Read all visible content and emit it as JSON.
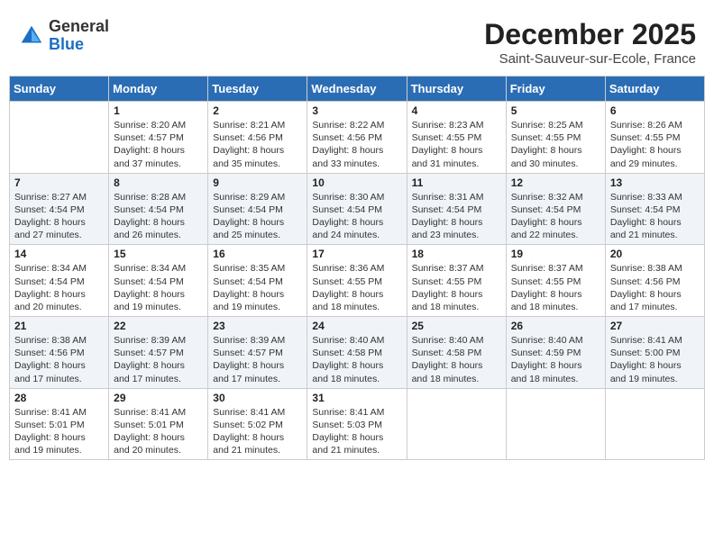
{
  "header": {
    "logo_general": "General",
    "logo_blue": "Blue",
    "title": "December 2025",
    "subtitle": "Saint-Sauveur-sur-Ecole, France"
  },
  "days_of_week": [
    "Sunday",
    "Monday",
    "Tuesday",
    "Wednesday",
    "Thursday",
    "Friday",
    "Saturday"
  ],
  "weeks": [
    {
      "days": [
        {
          "number": "",
          "info": ""
        },
        {
          "number": "1",
          "info": "Sunrise: 8:20 AM\nSunset: 4:57 PM\nDaylight: 8 hours\nand 37 minutes."
        },
        {
          "number": "2",
          "info": "Sunrise: 8:21 AM\nSunset: 4:56 PM\nDaylight: 8 hours\nand 35 minutes."
        },
        {
          "number": "3",
          "info": "Sunrise: 8:22 AM\nSunset: 4:56 PM\nDaylight: 8 hours\nand 33 minutes."
        },
        {
          "number": "4",
          "info": "Sunrise: 8:23 AM\nSunset: 4:55 PM\nDaylight: 8 hours\nand 31 minutes."
        },
        {
          "number": "5",
          "info": "Sunrise: 8:25 AM\nSunset: 4:55 PM\nDaylight: 8 hours\nand 30 minutes."
        },
        {
          "number": "6",
          "info": "Sunrise: 8:26 AM\nSunset: 4:55 PM\nDaylight: 8 hours\nand 29 minutes."
        }
      ]
    },
    {
      "days": [
        {
          "number": "7",
          "info": "Sunrise: 8:27 AM\nSunset: 4:54 PM\nDaylight: 8 hours\nand 27 minutes."
        },
        {
          "number": "8",
          "info": "Sunrise: 8:28 AM\nSunset: 4:54 PM\nDaylight: 8 hours\nand 26 minutes."
        },
        {
          "number": "9",
          "info": "Sunrise: 8:29 AM\nSunset: 4:54 PM\nDaylight: 8 hours\nand 25 minutes."
        },
        {
          "number": "10",
          "info": "Sunrise: 8:30 AM\nSunset: 4:54 PM\nDaylight: 8 hours\nand 24 minutes."
        },
        {
          "number": "11",
          "info": "Sunrise: 8:31 AM\nSunset: 4:54 PM\nDaylight: 8 hours\nand 23 minutes."
        },
        {
          "number": "12",
          "info": "Sunrise: 8:32 AM\nSunset: 4:54 PM\nDaylight: 8 hours\nand 22 minutes."
        },
        {
          "number": "13",
          "info": "Sunrise: 8:33 AM\nSunset: 4:54 PM\nDaylight: 8 hours\nand 21 minutes."
        }
      ]
    },
    {
      "days": [
        {
          "number": "14",
          "info": "Sunrise: 8:34 AM\nSunset: 4:54 PM\nDaylight: 8 hours\nand 20 minutes."
        },
        {
          "number": "15",
          "info": "Sunrise: 8:34 AM\nSunset: 4:54 PM\nDaylight: 8 hours\nand 19 minutes."
        },
        {
          "number": "16",
          "info": "Sunrise: 8:35 AM\nSunset: 4:54 PM\nDaylight: 8 hours\nand 19 minutes."
        },
        {
          "number": "17",
          "info": "Sunrise: 8:36 AM\nSunset: 4:55 PM\nDaylight: 8 hours\nand 18 minutes."
        },
        {
          "number": "18",
          "info": "Sunrise: 8:37 AM\nSunset: 4:55 PM\nDaylight: 8 hours\nand 18 minutes."
        },
        {
          "number": "19",
          "info": "Sunrise: 8:37 AM\nSunset: 4:55 PM\nDaylight: 8 hours\nand 18 minutes."
        },
        {
          "number": "20",
          "info": "Sunrise: 8:38 AM\nSunset: 4:56 PM\nDaylight: 8 hours\nand 17 minutes."
        }
      ]
    },
    {
      "days": [
        {
          "number": "21",
          "info": "Sunrise: 8:38 AM\nSunset: 4:56 PM\nDaylight: 8 hours\nand 17 minutes."
        },
        {
          "number": "22",
          "info": "Sunrise: 8:39 AM\nSunset: 4:57 PM\nDaylight: 8 hours\nand 17 minutes."
        },
        {
          "number": "23",
          "info": "Sunrise: 8:39 AM\nSunset: 4:57 PM\nDaylight: 8 hours\nand 17 minutes."
        },
        {
          "number": "24",
          "info": "Sunrise: 8:40 AM\nSunset: 4:58 PM\nDaylight: 8 hours\nand 18 minutes."
        },
        {
          "number": "25",
          "info": "Sunrise: 8:40 AM\nSunset: 4:58 PM\nDaylight: 8 hours\nand 18 minutes."
        },
        {
          "number": "26",
          "info": "Sunrise: 8:40 AM\nSunset: 4:59 PM\nDaylight: 8 hours\nand 18 minutes."
        },
        {
          "number": "27",
          "info": "Sunrise: 8:41 AM\nSunset: 5:00 PM\nDaylight: 8 hours\nand 19 minutes."
        }
      ]
    },
    {
      "days": [
        {
          "number": "28",
          "info": "Sunrise: 8:41 AM\nSunset: 5:01 PM\nDaylight: 8 hours\nand 19 minutes."
        },
        {
          "number": "29",
          "info": "Sunrise: 8:41 AM\nSunset: 5:01 PM\nDaylight: 8 hours\nand 20 minutes."
        },
        {
          "number": "30",
          "info": "Sunrise: 8:41 AM\nSunset: 5:02 PM\nDaylight: 8 hours\nand 21 minutes."
        },
        {
          "number": "31",
          "info": "Sunrise: 8:41 AM\nSunset: 5:03 PM\nDaylight: 8 hours\nand 21 minutes."
        },
        {
          "number": "",
          "info": ""
        },
        {
          "number": "",
          "info": ""
        },
        {
          "number": "",
          "info": ""
        }
      ]
    }
  ]
}
